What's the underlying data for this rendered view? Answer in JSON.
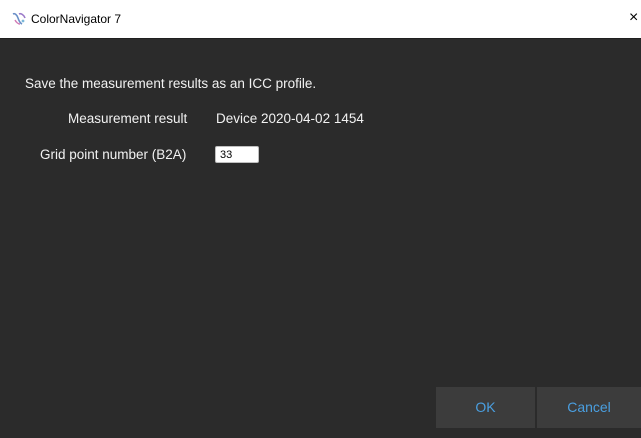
{
  "window": {
    "title": "ColorNavigator 7",
    "close_glyph": "×",
    "icon": "colornavigator-app-icon",
    "background": "#2b2b2b",
    "titlebar_background": "#ffffff"
  },
  "dialog": {
    "instruction": "Save the measurement results as an ICC profile.",
    "fields": {
      "measurement_result": {
        "label": "Measurement result",
        "value": "Device 2020-04-02 1454"
      },
      "grid_point_number": {
        "label": "Grid point number (B2A)",
        "value": "33"
      }
    }
  },
  "buttons": {
    "ok_label": "OK",
    "cancel_label": "Cancel",
    "accent": "#4a9fe0",
    "button_background": "#3c3c3c"
  }
}
